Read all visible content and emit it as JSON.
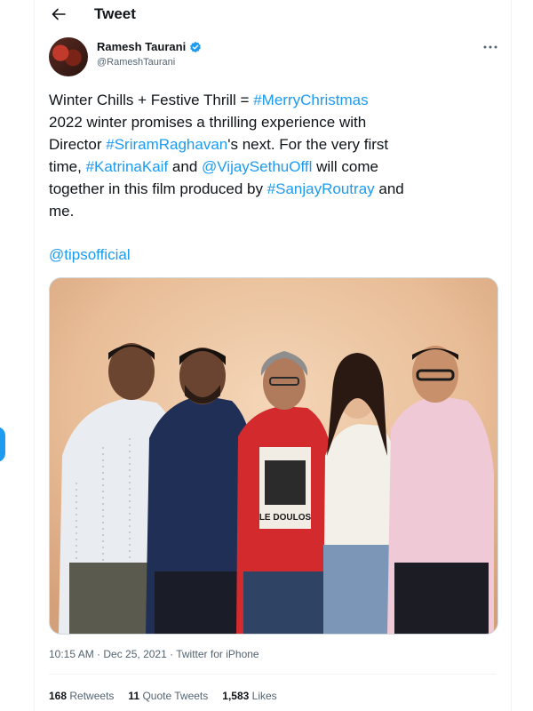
{
  "header": {
    "title": "Tweet",
    "back_icon": "arrow-left-icon"
  },
  "author": {
    "name": "Ramesh Taurani",
    "handle": "@RameshTaurani",
    "verified": true,
    "verified_color": "#1d9bf0"
  },
  "tweet": {
    "lines": [
      [
        {
          "t": "Winter Chills + Festive Thrill = ",
          "link": false
        },
        {
          "t": "#MerryChristmas",
          "link": true
        }
      ],
      [
        {
          "t": "2022 winter promises a thrilling experience with",
          "link": false
        }
      ],
      [
        {
          "t": "Director ",
          "link": false
        },
        {
          "t": "#SriramRaghavan",
          "link": true
        },
        {
          "t": "'s next. For the very first",
          "link": false
        }
      ],
      [
        {
          "t": "time, ",
          "link": false
        },
        {
          "t": "#KatrinaKaif",
          "link": true
        },
        {
          "t": " and ",
          "link": false
        },
        {
          "t": "@VijaySethuOffl",
          "link": true
        },
        {
          "t": " will come",
          "link": false
        }
      ],
      [
        {
          "t": "together in this film produced by ",
          "link": false
        },
        {
          "t": "#SanjayRoutray",
          "link": true
        },
        {
          "t": " and",
          "link": false
        }
      ],
      [
        {
          "t": "me.",
          "link": false
        }
      ]
    ],
    "mention": "@tipsofficial",
    "link_color": "#1d9bf0"
  },
  "media": {
    "image_alt": "Five people posing together in front of a beige backdrop",
    "tshirt_text": "LE DOULOS"
  },
  "meta": {
    "time": "10:15 AM",
    "separator1": " · ",
    "date": "Dec 25, 2021",
    "separator2": " · ",
    "source": "Twitter for iPhone"
  },
  "stats": {
    "retweets_count": "168",
    "retweets_label": "Retweets",
    "quotes_count": "11",
    "quotes_label": "Quote Tweets",
    "likes_count": "1,583",
    "likes_label": "Likes"
  },
  "colors": {
    "accent": "#1d9bf0",
    "text": "#0f1419",
    "muted": "#536471",
    "border": "#eff3f4"
  }
}
